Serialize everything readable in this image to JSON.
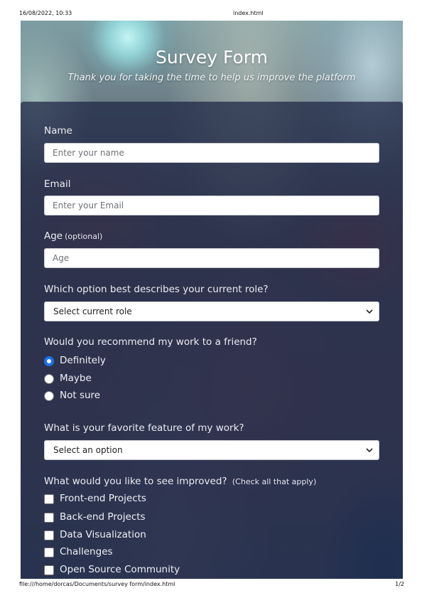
{
  "print_header": {
    "datetime": "16/08/2022, 10:33",
    "doc_title": "index.html"
  },
  "print_footer": {
    "url": "file:///home/dorcas/Documents/survey form/index.html",
    "page": "1/2"
  },
  "header": {
    "title": "Survey Form",
    "subtitle": "Thank you for taking the time to help us improve the platform"
  },
  "form": {
    "name": {
      "label": "Name",
      "placeholder": "Enter your name",
      "value": ""
    },
    "email": {
      "label": "Email",
      "placeholder": "Enter your Email",
      "value": ""
    },
    "age": {
      "label": "Age",
      "note": "(optional)",
      "placeholder": "Age",
      "value": ""
    },
    "role": {
      "label": "Which option best describes your current role?",
      "selected": "Select current role"
    },
    "recommend": {
      "label": "Would you recommend my work to a friend?",
      "options": [
        {
          "label": "Definitely",
          "checked": true
        },
        {
          "label": "Maybe",
          "checked": false
        },
        {
          "label": "Not sure",
          "checked": false
        }
      ]
    },
    "favorite": {
      "label": "What is your favorite feature of my work?",
      "selected": "Select an option"
    },
    "improve": {
      "label": "What would you like to see improved?",
      "note": "(Check all that apply)",
      "options": [
        {
          "label": "Front-end Projects",
          "checked": false
        },
        {
          "label": "Back-end Projects",
          "checked": false
        },
        {
          "label": "Data Visualization",
          "checked": false
        },
        {
          "label": "Challenges",
          "checked": false
        },
        {
          "label": "Open Source Community",
          "checked": false
        }
      ]
    }
  },
  "colors": {
    "accent": "#1a73e8",
    "panel": "#1c2442"
  }
}
